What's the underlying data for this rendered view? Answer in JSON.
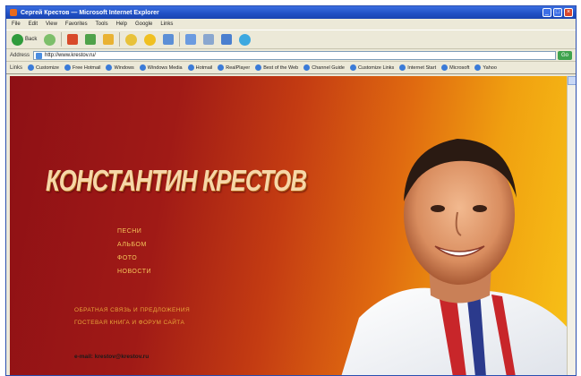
{
  "window": {
    "title": "Сергей Крестов — Microsoft Internet Explorer",
    "controls": [
      "_",
      "□",
      "×"
    ]
  },
  "menubar": [
    "File",
    "Edit",
    "View",
    "Favorites",
    "Tools",
    "Help",
    "Google",
    "Links"
  ],
  "toolbar": {
    "back_label": "Back",
    "icons": [
      "back-icon",
      "forward-icon",
      "stop-icon",
      "refresh-icon",
      "home-icon",
      "search-icon",
      "favorites-icon",
      "history-icon",
      "mail-icon",
      "print-icon"
    ]
  },
  "address": {
    "label": "Address",
    "url": "http://www.krestov.ru/",
    "go_label": "Go"
  },
  "links": {
    "label": "Links",
    "items": [
      "Customize",
      "Free Hotmail",
      "Windows",
      "Windows Media",
      "Hotmail",
      "RealPlayer",
      "Best of the Web",
      "Channel Guide",
      "Customize Links",
      "Internet Start",
      "Microsoft",
      "Yahoo"
    ]
  },
  "page": {
    "title": "КОНСТАНТИН КРЕСТОВ",
    "menu": [
      "ПЕСНИ",
      "АЛЬБОМ",
      "ФОТО",
      "НОВОСТИ"
    ],
    "menu2": [
      "ОБРАТНАЯ СВЯЗЬ И ПРЕДЛОЖЕНИЯ",
      "ГОСТЕВАЯ КНИГА И ФОРУМ САЙТА"
    ],
    "email": "e-mail: krestov@krestov.ru"
  },
  "colors": {
    "bg_left": "#8e1015",
    "bg_right": "#f8c418",
    "title_text": "#f6d7a8",
    "menu_text": "#f3c45a"
  }
}
